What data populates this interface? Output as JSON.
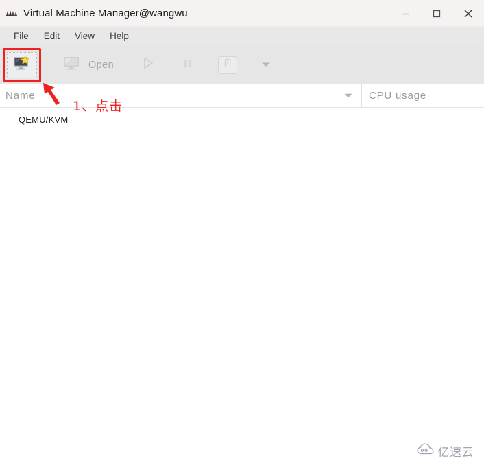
{
  "window": {
    "title": "Virtual Machine Manager@wangwu",
    "app_icon": "vmm-app-icon",
    "controls": {
      "minimize": "minimize-button",
      "maximize": "maximize-button",
      "close": "close-button"
    }
  },
  "menubar": {
    "items": [
      {
        "label": "File"
      },
      {
        "label": "Edit"
      },
      {
        "label": "View"
      },
      {
        "label": "Help"
      }
    ]
  },
  "toolbar": {
    "new_vm": {
      "icon": "new-virtual-machine-icon",
      "highlighted": true
    },
    "open": {
      "label": "Open",
      "icon": "monitor-icon",
      "enabled": false
    },
    "run": {
      "icon": "play-icon",
      "enabled": false
    },
    "pause": {
      "icon": "pause-icon",
      "enabled": false
    },
    "shutdown": {
      "icon": "power-icon",
      "enabled": false
    },
    "shutdown_menu": {
      "icon": "chevron-down-icon",
      "enabled": false
    }
  },
  "list": {
    "columns": [
      {
        "label": "Name",
        "sort_icon": "chevron-down-icon"
      },
      {
        "label": "CPU usage"
      }
    ],
    "rows": [
      {
        "name": "QEMU/KVM",
        "cpu_usage": ""
      }
    ]
  },
  "annotation": {
    "step_text": "1、点击",
    "arrow": "red-arrow-pointing-up-left",
    "color": "#ef2020"
  },
  "watermark": {
    "text": "亿速云",
    "icon": "cloud-logo-icon"
  },
  "colors": {
    "titlebar_bg": "#f7f2f2",
    "menubar_bg": "#e8e8e8",
    "toolbar_bg": "#e6e6e6",
    "content_bg": "#ffffff",
    "accent_red": "#ef2020",
    "header_text": "#9b9b9b"
  }
}
